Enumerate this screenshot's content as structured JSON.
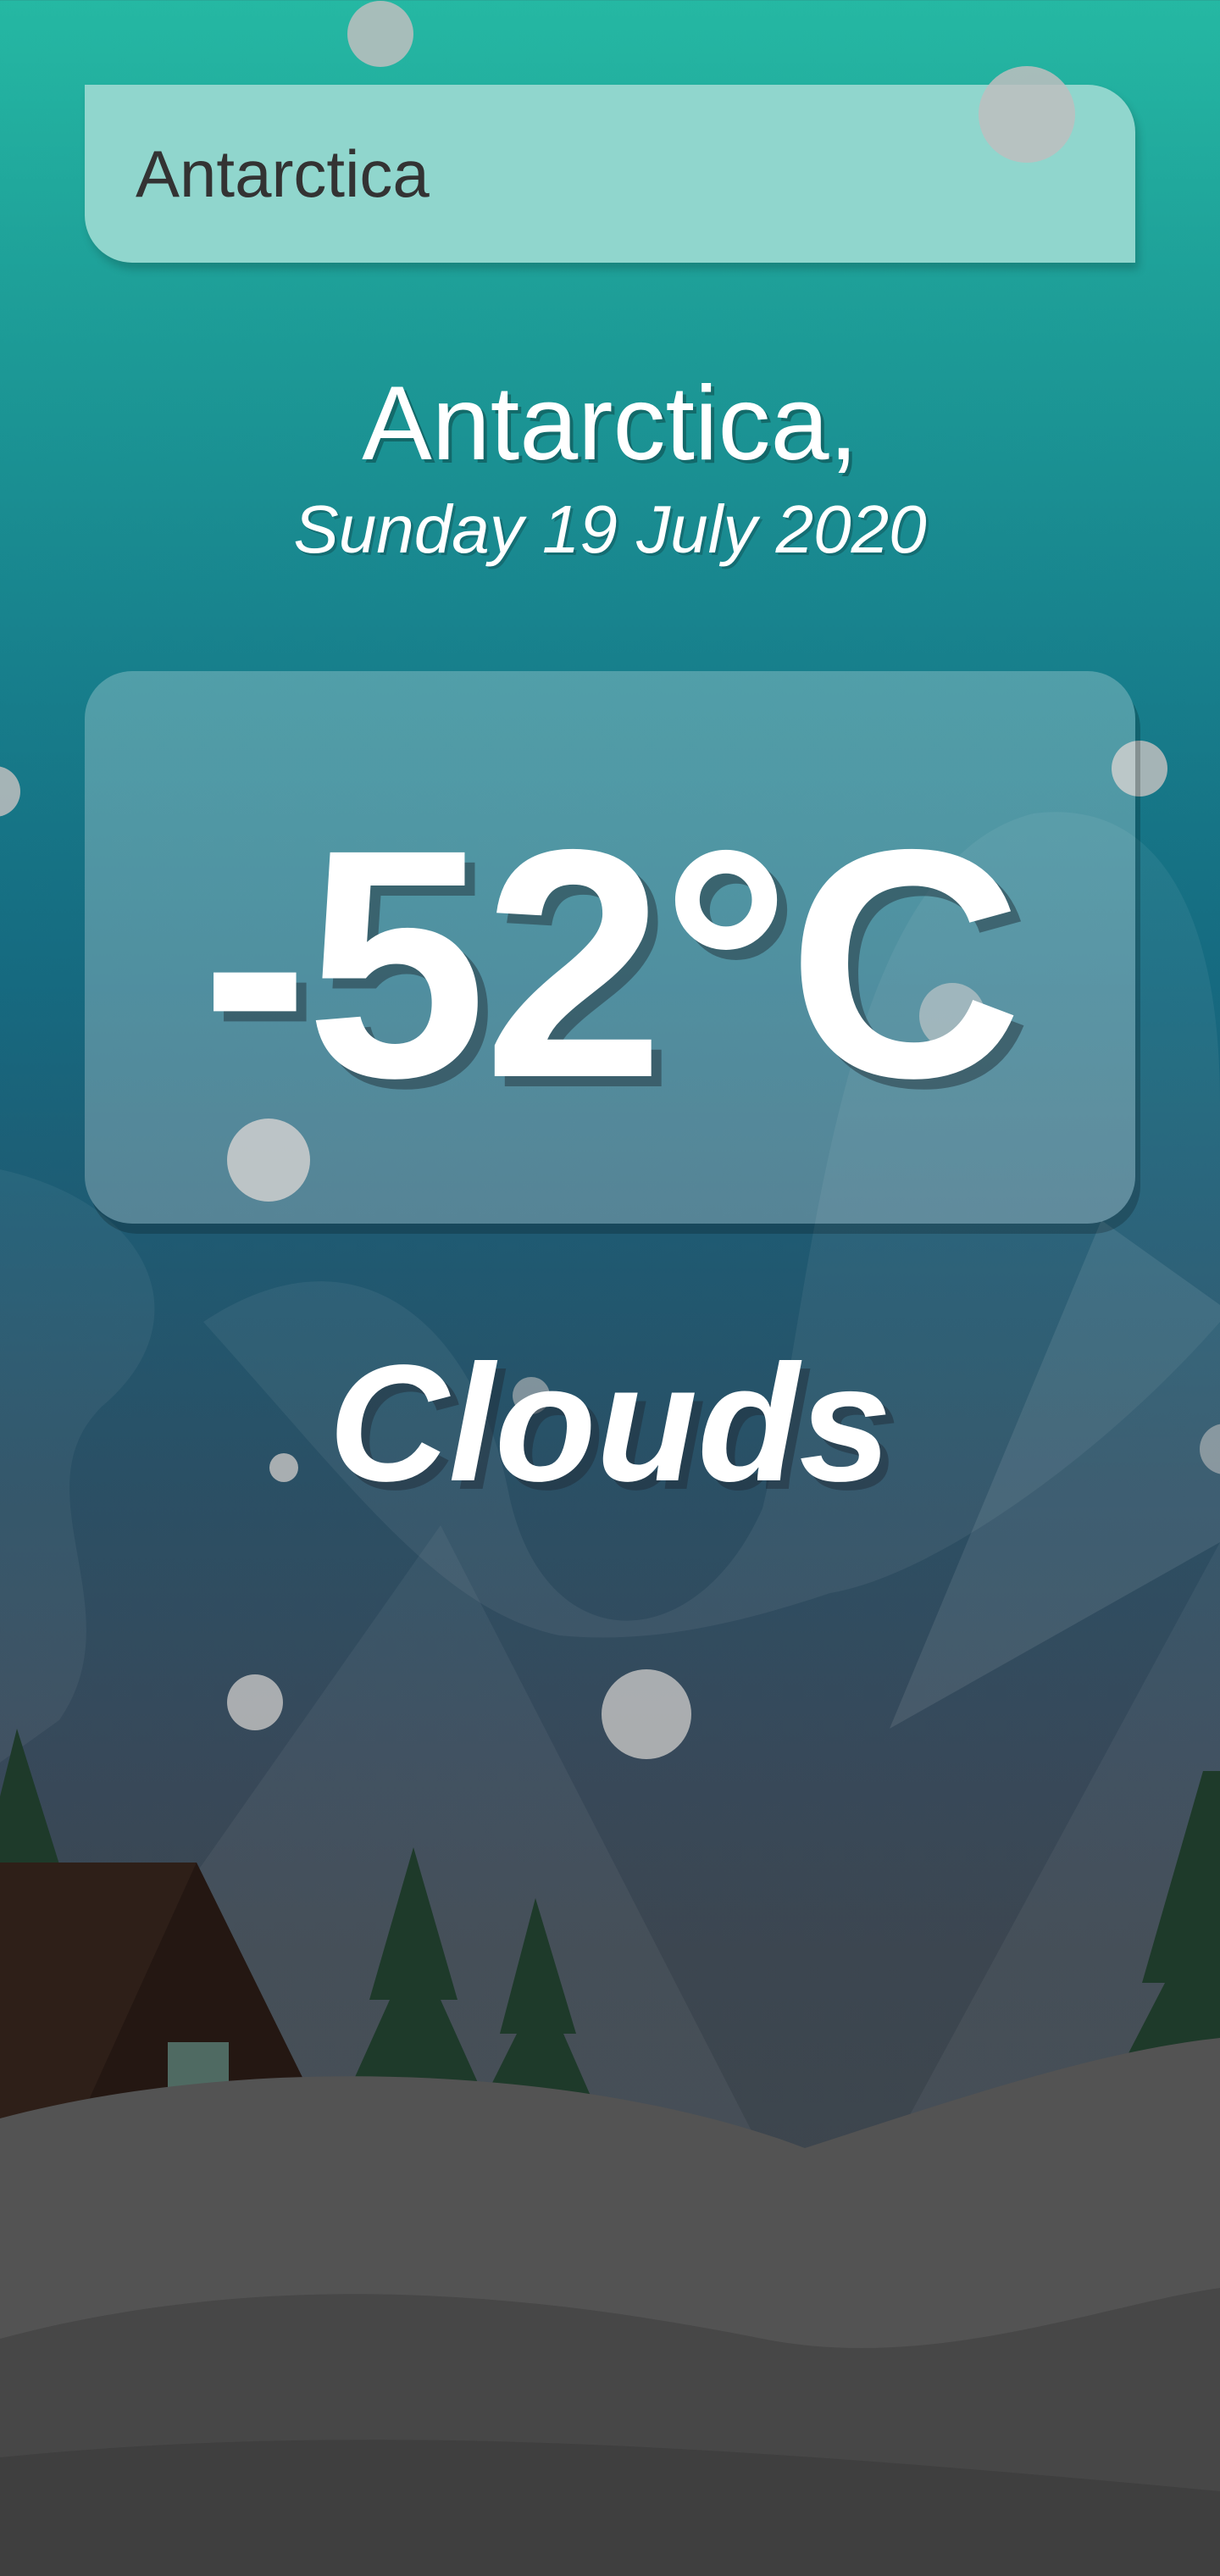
{
  "search": {
    "value": "Antarctica"
  },
  "weather": {
    "location": "Antarctica,",
    "date": "Sunday 19 July 2020",
    "temperature": "-52°C",
    "condition": "Clouds"
  },
  "colors": {
    "search_bg": "#90d6cd",
    "sky_top": "#25b8a3",
    "sky_mid": "#166a80",
    "ground": "#404448",
    "trees": "#1e3a2a",
    "cabin": "#241712",
    "door": "#4f6a62",
    "snow_dots": "#bebebe"
  }
}
